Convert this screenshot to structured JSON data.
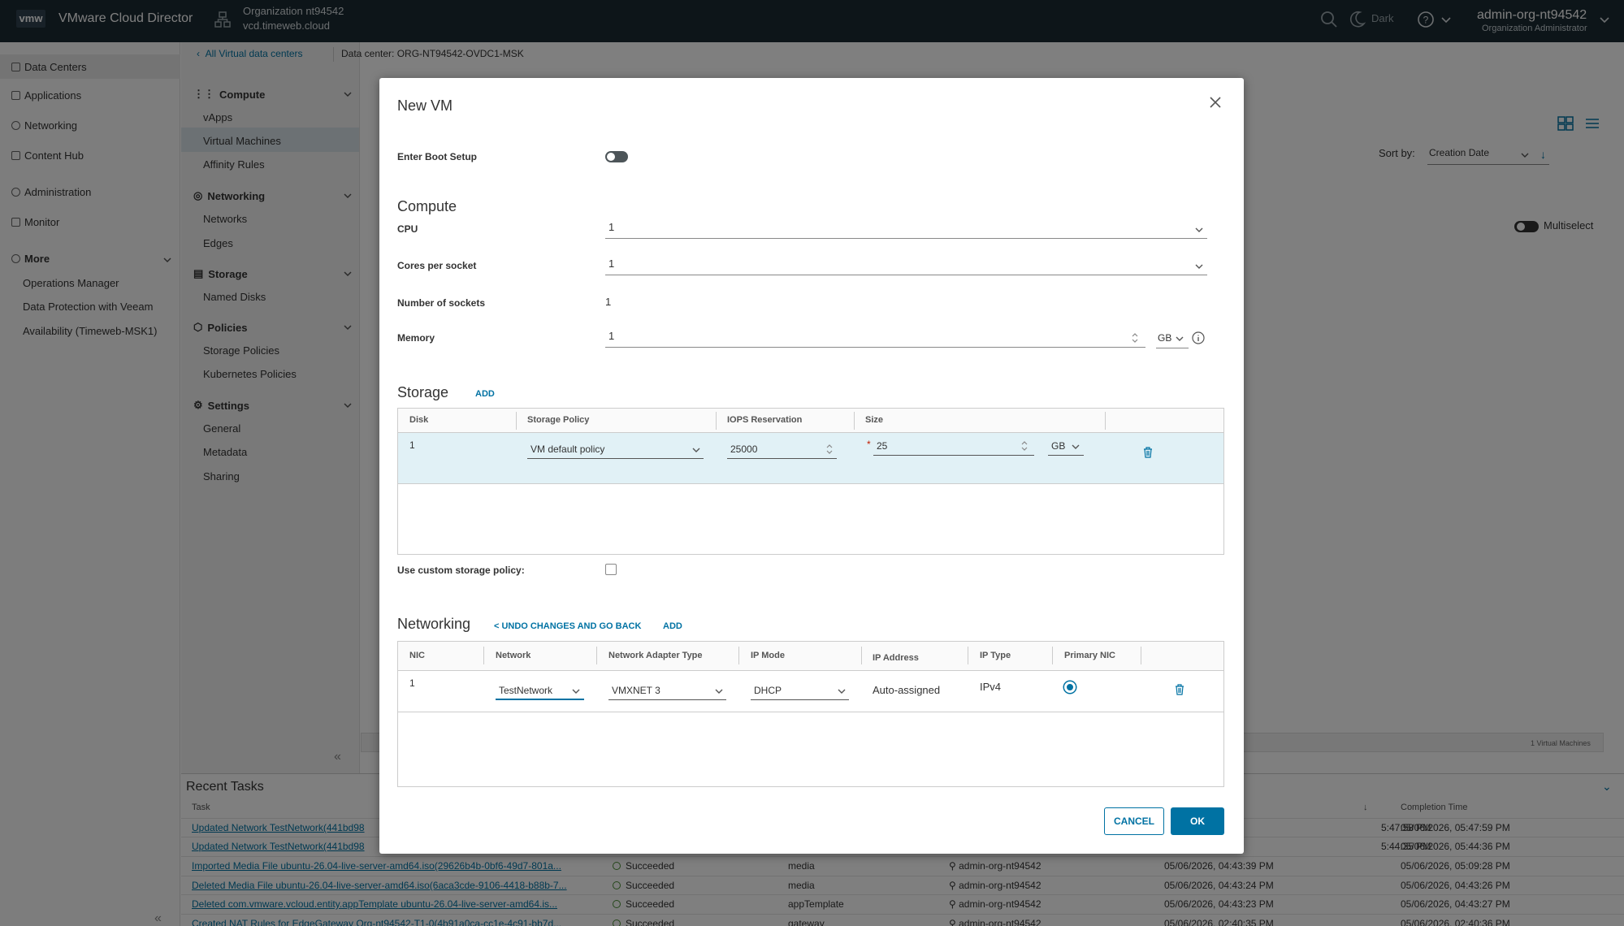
{
  "topbar": {
    "logo": "vmw",
    "title": "VMware Cloud Director",
    "org_name": "Organization nt94542",
    "org_host": "vcd.timeweb.cloud",
    "theme_label": "Dark",
    "user_name": "admin-org-nt94542",
    "user_role": "Organization Administrator"
  },
  "leftnav": {
    "items": [
      {
        "label": "Data Centers",
        "icon": "datacenter-icon"
      },
      {
        "label": "Applications",
        "icon": "applications-icon"
      },
      {
        "label": "Networking",
        "icon": "networking-icon"
      },
      {
        "label": "Content Hub",
        "icon": "content-hub-icon"
      },
      {
        "label": "Administration",
        "icon": "administration-icon"
      },
      {
        "label": "Monitor",
        "icon": "monitor-icon"
      }
    ],
    "more_label": "More",
    "more_items": [
      "Operations Manager",
      "Data Protection with Veeam",
      "Availability (Timeweb-MSK1)"
    ]
  },
  "secnav": {
    "compute": {
      "label": "Compute",
      "items": [
        "vApps",
        "Virtual Machines",
        "Affinity Rules"
      ]
    },
    "networking": {
      "label": "Networking",
      "items": [
        "Networks",
        "Edges"
      ]
    },
    "storage": {
      "label": "Storage",
      "items": [
        "Named Disks"
      ]
    },
    "policies": {
      "label": "Policies",
      "items": [
        "Storage Policies",
        "Kubernetes Policies"
      ]
    },
    "settings": {
      "label": "Settings",
      "items": [
        "General",
        "Metadata",
        "Sharing"
      ]
    }
  },
  "breadcrumb": {
    "back": "All Virtual data centers",
    "dc_label": "Data center:",
    "dc_value": "ORG-NT94542-OVDC1-MSK"
  },
  "content": {
    "sort_label": "Sort by:",
    "sort_value": "Creation Date",
    "multiselect": "Multiselect",
    "vm_count": "1 Virtual Machines"
  },
  "tasks": {
    "title": "Recent Tasks",
    "col_task": "Task",
    "col_completion": "Completion Time",
    "rows": [
      {
        "task": "Updated Network TestNetwork(441bd98",
        "status": "",
        "type": "",
        "owner": "",
        "start": "5:47:58 PM",
        "end": "05/06/2026, 05:47:59 PM"
      },
      {
        "task": "Updated Network TestNetwork(441bd98",
        "status": "",
        "type": "",
        "owner": "",
        "start": "5:44:35 PM",
        "end": "05/06/2026, 05:44:36 PM"
      },
      {
        "task": "Imported Media File ubuntu-26.04-live-server-amd64.iso(29626b4b-0bf6-49d7-801a...",
        "status": "Succeeded",
        "type": "media",
        "owner": "admin-org-nt94542",
        "start": "05/06/2026, 04:43:39 PM",
        "end": "05/06/2026, 05:09:28 PM"
      },
      {
        "task": "Deleted Media File ubuntu-26.04-live-server-amd64.iso(6aca3cde-9106-4418-b88b-7...",
        "status": "Succeeded",
        "type": "media",
        "owner": "admin-org-nt94542",
        "start": "05/06/2026, 04:43:24 PM",
        "end": "05/06/2026, 04:43:26 PM"
      },
      {
        "task": "Deleted com.vmware.vcloud.entity.appTemplate ubuntu-26.04-live-server-amd64.is...",
        "status": "Succeeded",
        "type": "appTemplate",
        "owner": "admin-org-nt94542",
        "start": "05/06/2026, 04:43:23 PM",
        "end": "05/06/2026, 04:43:27 PM"
      },
      {
        "task": "Created NAT Rules for EdgeGateway Org-nt94542-T1-0(4b91a0ca-cc1e-4c91-bb7d...",
        "status": "Succeeded",
        "type": "gateway",
        "owner": "admin-org-nt94542",
        "start": "05/06/2026, 02:40:35 PM",
        "end": "05/06/2026, 02:40:36 PM"
      }
    ]
  },
  "modal": {
    "title": "New VM",
    "boot_setup_label": "Enter Boot Setup",
    "compute_heading": "Compute",
    "cpu_label": "CPU",
    "cpu_value": "1",
    "cores_label": "Cores per socket",
    "cores_value": "1",
    "sockets_label": "Number of sockets",
    "sockets_value": "1",
    "memory_label": "Memory",
    "memory_value": "1",
    "memory_unit": "GB",
    "storage_heading": "Storage",
    "storage_add": "ADD",
    "storage_table": {
      "headers": [
        "Disk",
        "Storage Policy",
        "IOPS Reservation",
        "Size"
      ],
      "row": {
        "disk": "1",
        "policy": "VM default policy",
        "iops": "25000",
        "size": "25",
        "unit": "GB"
      }
    },
    "custom_policy_label": "Use custom storage policy:",
    "networking_heading": "Networking",
    "undo_link": "< UNDO CHANGES AND GO BACK",
    "networking_add": "ADD",
    "net_table": {
      "headers": [
        "NIC",
        "Network",
        "Network Adapter Type",
        "IP Mode",
        "IP Address",
        "IP Type",
        "Primary NIC"
      ],
      "row": {
        "nic": "1",
        "network": "TestNetwork",
        "adapter": "VMXNET 3",
        "ip_mode": "DHCP",
        "ip_address": "Auto-assigned",
        "ip_type": "IPv4"
      }
    },
    "cancel": "CANCEL",
    "ok": "OK"
  }
}
